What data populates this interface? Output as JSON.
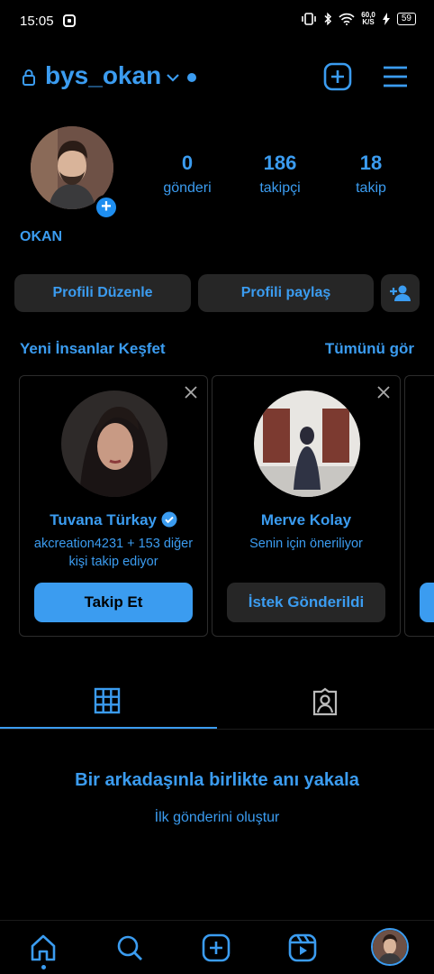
{
  "status_bar": {
    "time": "15:05",
    "net_speed_value": "60,0",
    "net_speed_unit": "K/S",
    "battery": "59"
  },
  "header": {
    "username": "bys_okan"
  },
  "profile": {
    "display_name": "OKAN",
    "stats": [
      {
        "value": "0",
        "label": "gönderi"
      },
      {
        "value": "186",
        "label": "takipçi"
      },
      {
        "value": "18",
        "label": "takip"
      }
    ],
    "edit_label": "Profili Düzenle",
    "share_label": "Profili paylaş"
  },
  "discover": {
    "title": "Yeni İnsanlar Keşfet",
    "see_all": "Tümünü gör",
    "cards": [
      {
        "name": "Tuvana Türkay",
        "subtitle": "akcreation4231 + 153 diğer kişi takip ediyor",
        "button": "Takip Et",
        "verified": true
      },
      {
        "name": "Merve Kolay",
        "subtitle": "Senin için öneriliyor",
        "button": "İstek Gönderildi",
        "verified": false
      }
    ]
  },
  "empty_state": {
    "title": "Bir arkadaşınla birlikte anı yakala",
    "link": "İlk gönderini oluştur"
  },
  "colors": {
    "accent": "#3b9cf0",
    "background": "#000000",
    "button_bg": "#262626",
    "primary_button": "#3b9cf0"
  }
}
